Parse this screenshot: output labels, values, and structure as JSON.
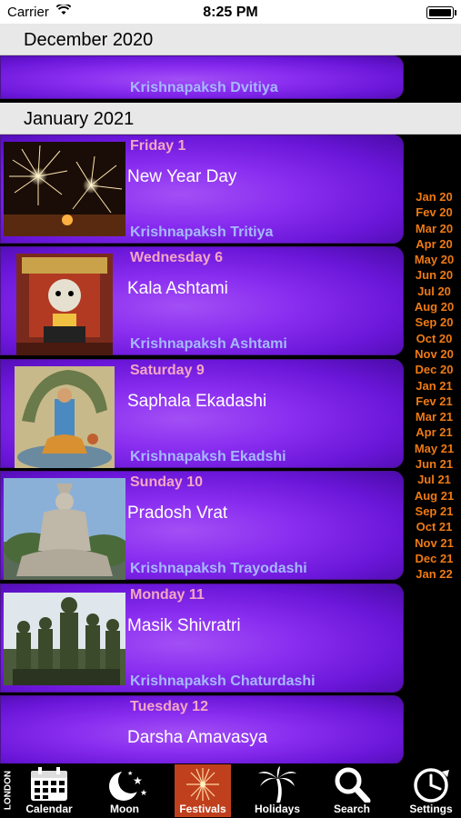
{
  "status_bar": {
    "carrier": "Carrier",
    "time": "8:25 PM"
  },
  "sections": [
    {
      "month": "December 2020"
    },
    {
      "month": "January 2021"
    }
  ],
  "december_events": [
    {
      "paksh": "Krishnapaksh Dvitiya"
    }
  ],
  "events": [
    {
      "date": "Friday 1",
      "title": "New Year Day",
      "paksh": "Krishnapaksh Tritiya",
      "image": "fireworks"
    },
    {
      "date": "Wednesday 6",
      "title": "Kala Ashtami",
      "paksh": "Krishnapaksh Ashtami",
      "image": "kala-bhairav-deity"
    },
    {
      "date": "Saturday 9",
      "title": "Saphala Ekadashi",
      "paksh": "Krishnapaksh Ekadshi",
      "image": "vishnu-on-sheshnag"
    },
    {
      "date": "Sunday 10",
      "title": "Pradosh Vrat",
      "paksh": "Krishnapaksh Trayodashi",
      "image": "shiva-statue"
    },
    {
      "date": "Monday 11",
      "title": "Masik Shivratri",
      "paksh": "Krishnapaksh Chaturdashi",
      "image": "soldiers-marching"
    },
    {
      "date": "Tuesday 12",
      "title": "Darsha Amavasya"
    }
  ],
  "month_index": [
    "Jan 20",
    "Fev 20",
    "Mar 20",
    "Apr 20",
    "May 20",
    "Jun 20",
    "Jul 20",
    "Aug 20",
    "Sep 20",
    "Oct 20",
    "Nov 20",
    "Dec 20",
    "Jan 21",
    "Fev 21",
    "Mar 21",
    "Apr 21",
    "May 21",
    "Jun 21",
    "Jul 21",
    "Aug 21",
    "Sep 21",
    "Oct 21",
    "Nov 21",
    "Dec 21",
    "Jan 22"
  ],
  "location": "LONDON",
  "tabs": [
    {
      "label": "Calendar",
      "icon": "calendar-icon"
    },
    {
      "label": "Moon",
      "icon": "moon-icon"
    },
    {
      "label": "Festivals",
      "icon": "fireworks-icon",
      "active": true
    },
    {
      "label": "Holidays",
      "icon": "palm-tree-icon"
    },
    {
      "label": "Search",
      "icon": "search-icon"
    },
    {
      "label": "Settings",
      "icon": "clock-icon"
    }
  ],
  "colors": {
    "accent": "#ef7a13",
    "date_text": "#f4a6c4",
    "paksh_text": "#a6b8ff",
    "active_tab": "#c0401e",
    "card_purple": "#8a2ef0"
  }
}
